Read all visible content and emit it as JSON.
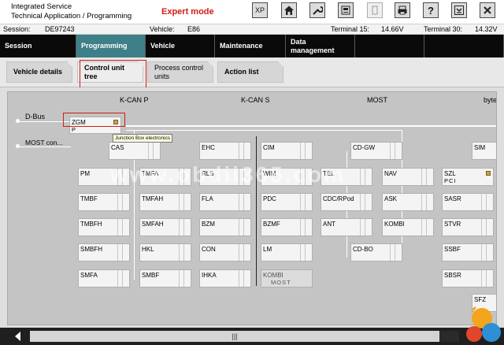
{
  "header": {
    "line1": "Integrated Service",
    "line2": "Technical Application / Programming",
    "mode": "Expert mode",
    "toolbar": [
      {
        "name": "xp-button",
        "label": "XP",
        "icon": "xp-text",
        "enabled": true
      },
      {
        "name": "home-button",
        "label": "",
        "icon": "home-icon",
        "enabled": true
      },
      {
        "name": "tools-button",
        "label": "",
        "icon": "wrench-icon",
        "enabled": true
      },
      {
        "name": "document-button",
        "label": "",
        "icon": "document-icon",
        "enabled": true
      },
      {
        "name": "copy-button",
        "label": "",
        "icon": "copy-icon",
        "enabled": false
      },
      {
        "name": "print-button",
        "label": "",
        "icon": "print-icon",
        "enabled": true
      },
      {
        "name": "help-button",
        "label": "?",
        "icon": "help-icon",
        "enabled": true
      },
      {
        "name": "minimize-button",
        "label": "",
        "icon": "minimize-icon",
        "enabled": true
      },
      {
        "name": "close-button",
        "label": "",
        "icon": "close-icon",
        "enabled": true
      }
    ]
  },
  "session": {
    "session_label": "Session:",
    "session_value": "DE97243",
    "vehicle_label": "Vehicle:",
    "vehicle_value": "E86",
    "t15_label": "Terminal 15:",
    "t15_value": "14.66V",
    "t30_label": "Terminal 30:",
    "t30_value": "14.32V"
  },
  "main_nav": {
    "session": "Session",
    "programming": "Programming",
    "vehicle": "Vehicle",
    "maintenance": "Maintenance",
    "data_management": "Data management"
  },
  "sub_nav": {
    "vehicle_details": "Vehicle details",
    "control_unit_tree": "Control unit tree",
    "process_control_units": "Process control units",
    "action_list": "Action list"
  },
  "diagram": {
    "buses": {
      "kcan_p": "K-CAN P",
      "kcan_s": "K-CAN S",
      "most": "MOST",
      "byte": "byte"
    },
    "side_labels": {
      "dbus": "D-Bus",
      "most_con": "MOST con..."
    },
    "tooltip": "Junction Box electronics",
    "ecus": {
      "zgm": "ZGM",
      "zgm_sub": "P",
      "cas": "CAS",
      "ehc": "EHC",
      "cim": "CIM",
      "cdgw": "CD-GW",
      "sim": "SIM",
      "pm": "PM",
      "tmfa": "TMFA",
      "rls": "RLS",
      "wim": "WIM",
      "tel": "TEL",
      "nav": "NAV",
      "szl": "SZL",
      "szl_sub": "PCI",
      "tmbf": "TMBF",
      "tmfah": "TMFAH",
      "fla": "FLA",
      "pdc": "PDC",
      "cdcrpod": "CDC/RPod",
      "ask": "ASK",
      "sasr": "SASR",
      "tmbfh": "TMBFH",
      "smfah": "SMFAH",
      "bzm": "BZM",
      "bzmf": "BZMF",
      "ant": "ANT",
      "kombi": "KOMBI",
      "stvr": "STVR",
      "smbfh": "SMBFH",
      "hkl": "HKL",
      "con": "CON",
      "lm": "LM",
      "cdbo": "CD-BO",
      "ssbf": "SSBF",
      "smfa": "SMFA",
      "smbf": "SMBF",
      "ihka": "IHKA",
      "kombi2": "KOMBI",
      "kombi2_sub": "MOST",
      "sbsr": "SBSR",
      "sfz": "SFZ"
    },
    "watermark": "www.obdii365.com"
  },
  "scrollbar": {
    "thumb_glyph": "|||"
  },
  "colors": {
    "expert_mode": "#d21c16",
    "active_tab": "#3e7f88",
    "nav_bg": "#000000",
    "highlight_box": "#d21c16"
  }
}
